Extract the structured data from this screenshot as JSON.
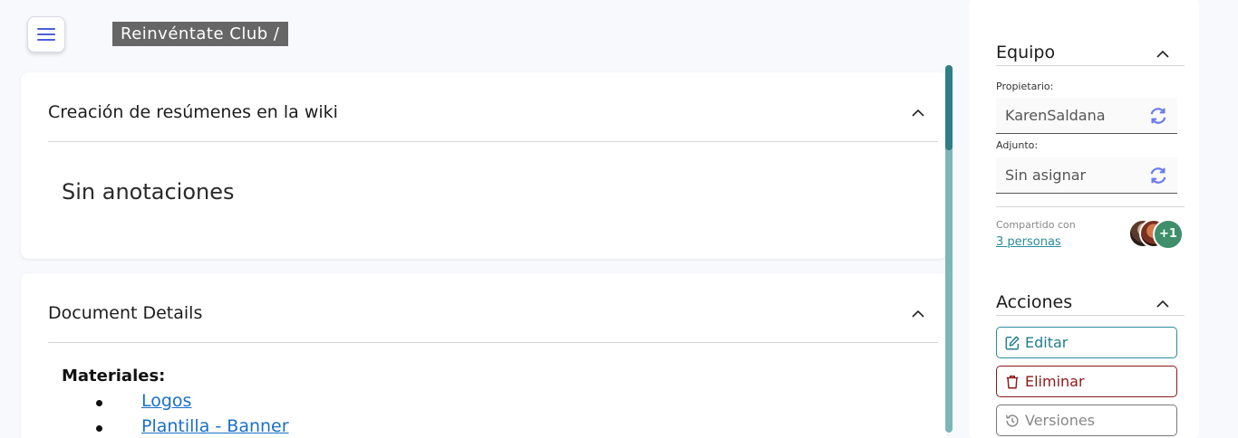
{
  "header": {
    "breadcrumb": "Reinvéntate Club /"
  },
  "main": {
    "annotations_card": {
      "title": "Creación de resúmenes en la wiki",
      "empty_text": "Sin anotaciones"
    },
    "details_card": {
      "title": "Document Details",
      "materials_label": "Materiales:",
      "materials": [
        {
          "label": "Logos"
        },
        {
          "label": "Plantilla - Banner"
        }
      ]
    }
  },
  "sidebar": {
    "team": {
      "title": "Equipo",
      "owner_label": "Propietario:",
      "owner_value": "KarenSaldana",
      "assignee_label": "Adjunto:",
      "assignee_value": "Sin asignar",
      "shared_label": "Compartido con",
      "shared_link": "3 personas",
      "avatar_more": "+1"
    },
    "actions": {
      "title": "Acciones",
      "edit_label": "Editar",
      "delete_label": "Eliminar",
      "versions_label": "Versiones"
    }
  },
  "colors": {
    "accent": "#2a8c9a",
    "danger": "#8b1a1a",
    "link": "#1a6fc9",
    "sync_icon": "#6b7bf0",
    "scroll_thumb": "#2e7f85"
  },
  "icons": [
    "hamburger-icon",
    "chevron-up-icon",
    "sync-icon",
    "edit-icon",
    "trash-icon",
    "history-icon"
  ]
}
